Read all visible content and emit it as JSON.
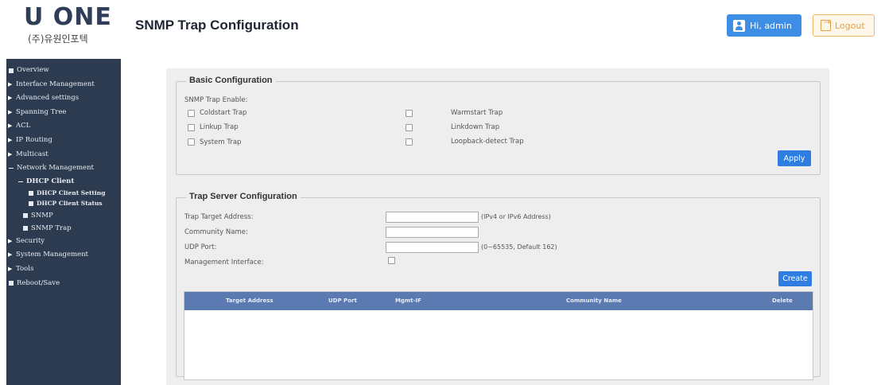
{
  "header": {
    "logo_text": "U ONE",
    "logo_subtitle": "(주)유원인포텍",
    "title": "SNMP Trap Configuration",
    "user_label": "Hi, admin",
    "logout_label": "Logout"
  },
  "sidebar": {
    "items": [
      {
        "label": "Overview"
      },
      {
        "label": "Interface Management"
      },
      {
        "label": "Advanced settings"
      },
      {
        "label": "Spanning Tree"
      },
      {
        "label": "ACL"
      },
      {
        "label": "IP Routing"
      },
      {
        "label": "Multicast"
      },
      {
        "label": "Network Management"
      },
      {
        "label": "DHCP Client"
      },
      {
        "label": "DHCP Client Setting"
      },
      {
        "label": "DHCP Client Status"
      },
      {
        "label": "SNMP"
      },
      {
        "label": "SNMP Trap"
      },
      {
        "label": "Security"
      },
      {
        "label": "System Management"
      },
      {
        "label": "Tools"
      },
      {
        "label": "Reboot/Save"
      }
    ]
  },
  "basic": {
    "legend": "Basic Configuration",
    "enable_label": "SNMP Trap Enable:",
    "coldstart": "Coldstart Trap",
    "warmstart": "Warmstart Trap",
    "linkup": "Linkup Trap",
    "linkdown": "Linkdown Trap",
    "system": "System Trap",
    "loopback": "Loopback-detect Trap",
    "apply_label": "Apply"
  },
  "server": {
    "legend": "Trap Server Configuration",
    "target_label": "Trap Target Address:",
    "target_hint": "(IPv4 or IPv6 Address)",
    "community_label": "Community Name:",
    "udp_label": "UDP Port:",
    "udp_hint": "(0~65535, Default 162)",
    "mgmt_label": "Management Interface:",
    "create_label": "Create",
    "table_headers": [
      "Target Address",
      "UDP Port",
      "Mgmt-IF",
      "Community Name",
      "Delete"
    ]
  }
}
